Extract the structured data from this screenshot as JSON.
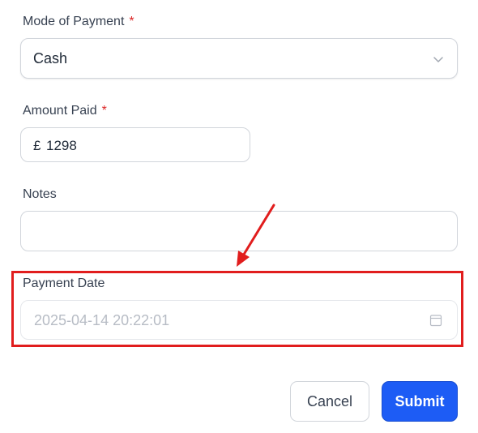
{
  "form": {
    "mode_of_payment": {
      "label": "Mode of Payment",
      "required_mark": "*",
      "value": "Cash"
    },
    "amount_paid": {
      "label": "Amount Paid",
      "required_mark": "*",
      "currency": "£",
      "value": "1298"
    },
    "notes": {
      "label": "Notes",
      "value": ""
    },
    "payment_date": {
      "label": "Payment Date",
      "value": "2025-04-14 20:22:01"
    }
  },
  "actions": {
    "cancel_label": "Cancel",
    "submit_label": "Submit"
  },
  "colors": {
    "accent": "#1d5cf5",
    "annotation": "#e11d1d",
    "required": "#dc2626"
  },
  "icons": {
    "select": "chevron-down-icon",
    "date": "calendar-icon",
    "annotation": "arrow-icon"
  }
}
